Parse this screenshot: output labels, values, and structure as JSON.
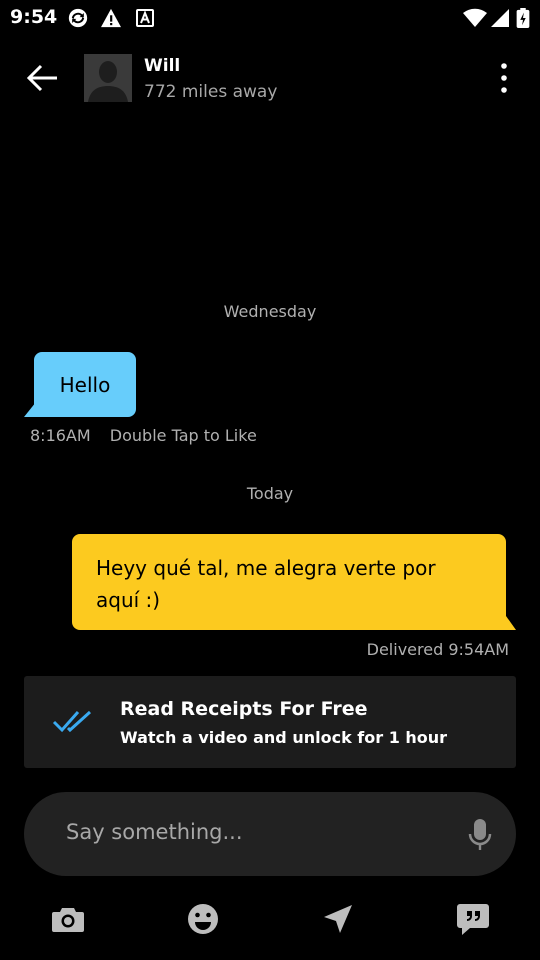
{
  "status_bar": {
    "time": "9:54",
    "icons": [
      "sync-icon",
      "warning-icon",
      "accessibility-icon",
      "wifi-icon",
      "signal-icon",
      "battery-icon"
    ]
  },
  "header": {
    "name": "Will",
    "distance": "772 miles away",
    "back_icon": "back-arrow-icon",
    "menu_icon": "more-vert-icon"
  },
  "conversation": {
    "day_label_1": "Wednesday",
    "incoming": {
      "text": "Hello",
      "time": "8:16AM",
      "hint": "Double Tap to Like",
      "bubble_color": "#67cdfb"
    },
    "day_label_2": "Today",
    "outgoing": {
      "text": "Heyy qué tal, me alegra verte por aquí :)",
      "status": "Delivered 9:54AM",
      "bubble_color": "#fcca1f"
    }
  },
  "promo": {
    "title": "Read Receipts For Free",
    "subtitle": "Watch a video and unlock for 1 hour",
    "icon": "double-check-icon",
    "accent": "#3aaaf0"
  },
  "composer": {
    "placeholder": "Say something...",
    "mic_icon": "microphone-icon"
  },
  "toolbar": {
    "items": [
      "camera-icon",
      "emoji-icon",
      "location-arrow-icon",
      "quick-replies-icon"
    ]
  }
}
